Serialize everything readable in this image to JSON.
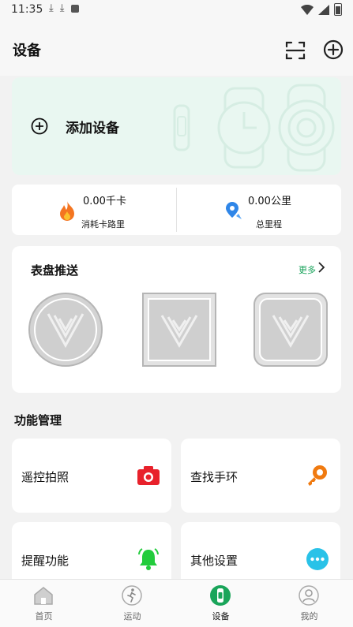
{
  "status_bar": {
    "time": "11:35"
  },
  "header": {
    "title": "设备"
  },
  "add_device": {
    "label": "添加设备"
  },
  "stats": [
    {
      "value": "0.00千卡",
      "label": "消耗卡路里",
      "icon": "flame-icon"
    },
    {
      "value": "0.00公里",
      "label": "总里程",
      "icon": "route-pin-icon"
    }
  ],
  "watch_faces": {
    "title": "表盘推送",
    "more": "更多",
    "items": [
      "round",
      "square",
      "rounded-square"
    ]
  },
  "functions": {
    "title": "功能管理",
    "items": [
      {
        "label": "遥控拍照",
        "icon": "camera-icon",
        "color": "#e8212b"
      },
      {
        "label": "查找手环",
        "icon": "key-search-icon",
        "color": "#f07a10"
      },
      {
        "label": "提醒功能",
        "icon": "bell-icon",
        "color": "#22cc3c"
      },
      {
        "label": "其他设置",
        "icon": "more-dots-icon",
        "color": "#29c2e8"
      }
    ]
  },
  "bottom_nav": [
    {
      "label": "首页",
      "icon": "home-icon",
      "active": false
    },
    {
      "label": "运动",
      "icon": "run-icon",
      "active": false
    },
    {
      "label": "设备",
      "icon": "watch-icon",
      "active": true,
      "color": "#1aa55a"
    },
    {
      "label": "我的",
      "icon": "profile-icon",
      "active": false
    }
  ]
}
